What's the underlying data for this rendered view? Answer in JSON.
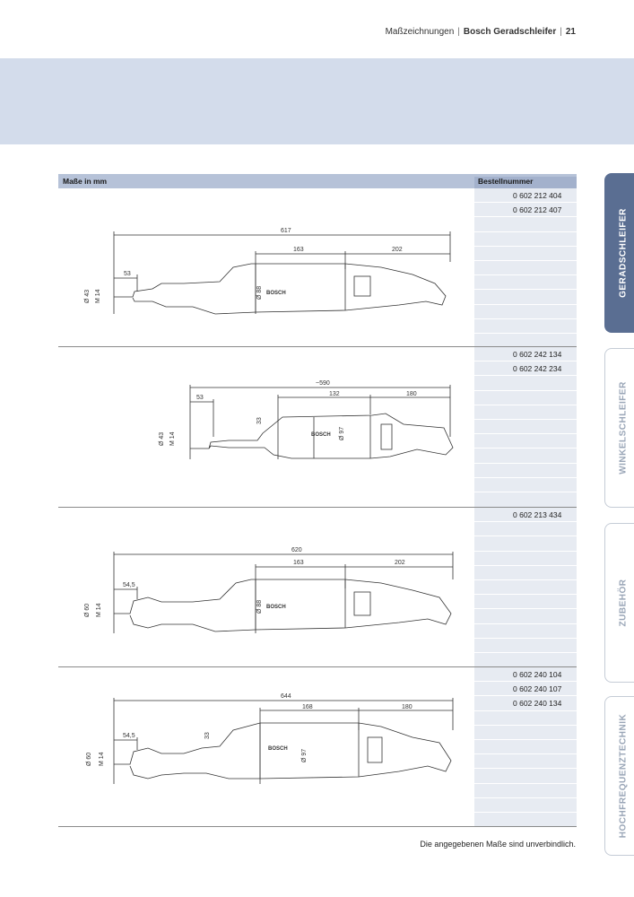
{
  "header": {
    "section": "Maßzeichnungen",
    "title": "Bosch Geradschleifer",
    "page": "21"
  },
  "table": {
    "col_dimensions": "Maße in mm",
    "col_order_number": "Bestellnummer"
  },
  "sections": [
    {
      "order_numbers": [
        "0 602 212 404",
        "0 602 212 407"
      ],
      "dims": {
        "total": "617",
        "a": "163",
        "b": "202",
        "c": "53",
        "d1": "Ø 43",
        "d2": "M 14",
        "body": "Ø 88",
        "brand": "BOSCH"
      }
    },
    {
      "order_numbers": [
        "0 602 242 134",
        "0 602 242 234"
      ],
      "dims": {
        "total": "~590",
        "a": "132",
        "b": "180",
        "c": "53",
        "d1": "Ø 43",
        "d2": "M 14",
        "body": "Ø 97",
        "neck": "33",
        "brand": "BOSCH"
      }
    },
    {
      "order_numbers": [
        "0 602 213 434"
      ],
      "dims": {
        "total": "620",
        "a": "163",
        "b": "202",
        "c": "54,5",
        "d1": "Ø 60",
        "d2": "M 14",
        "body": "Ø 88",
        "brand": "BOSCH"
      }
    },
    {
      "order_numbers": [
        "0 602 240 104",
        "0 602 240 107",
        "0 602 240 134"
      ],
      "dims": {
        "total": "644",
        "a": "168",
        "b": "180",
        "c": "54,5",
        "d1": "Ø 60",
        "d2": "M 14",
        "body": "Ø 97",
        "neck": "33",
        "brand": "BOSCH"
      }
    }
  ],
  "footer": "Die angegebenen Maße sind unverbindlich.",
  "tabs": [
    "GERADSCHLEIFER",
    "WINKELSCHLEIFER",
    "ZUBEHÖR",
    "HOCHFREQUENZTECHNIK"
  ],
  "colors": {
    "banner": "#d3dceb",
    "table_header": "#b6c2d8",
    "active_tab": "#5a6e92"
  }
}
